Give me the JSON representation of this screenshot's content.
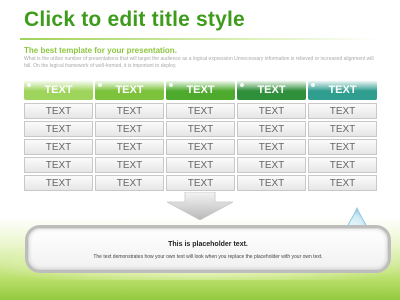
{
  "slide": {
    "title": "Click to edit title style",
    "subheading": "The best template for your presentation.",
    "subtext": "What is the utilize number of presentations that will target the audience as a logical expression Unnecessary information is relieved or increased alignment will fall. On the logical framework of well-formed, it is important to deploy."
  },
  "table": {
    "headers": [
      "TEXT",
      "TEXT",
      "TEXT",
      "TEXT",
      "TEXT"
    ],
    "header_colors": [
      "#9fd45c",
      "#7cc23b",
      "#4eaa2c",
      "#2f8f3a",
      "#2f9e8f"
    ],
    "rows": [
      [
        "TEXT",
        "TEXT",
        "TEXT",
        "TEXT",
        "TEXT"
      ],
      [
        "TEXT",
        "TEXT",
        "TEXT",
        "TEXT",
        "TEXT"
      ],
      [
        "TEXT",
        "TEXT",
        "TEXT",
        "TEXT",
        "TEXT"
      ],
      [
        "TEXT",
        "TEXT",
        "TEXT",
        "TEXT",
        "TEXT"
      ],
      [
        "TEXT",
        "TEXT",
        "TEXT",
        "TEXT",
        "TEXT"
      ]
    ]
  },
  "callout": {
    "title": "This is placeholder text.",
    "text": "The text demonstrates how your own text will look when you replace the placeholder with your own text."
  },
  "icons": {
    "arrow": "down-arrow-icon",
    "drops": "water-drop-icon"
  }
}
